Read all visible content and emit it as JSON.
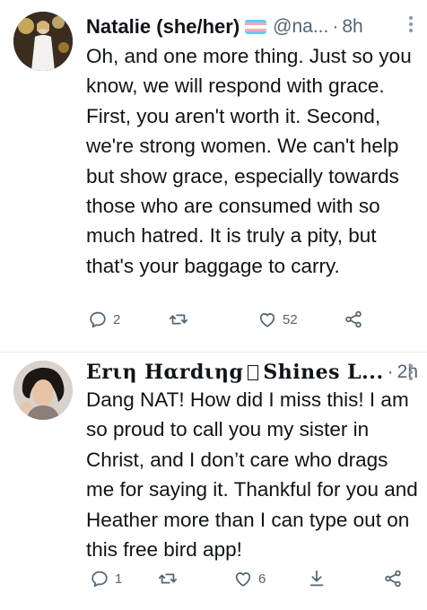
{
  "tweets": [
    {
      "author_name": "Natalie (she/her)",
      "handle": "@na...",
      "separator": "·",
      "time": "8h",
      "text": "Oh, and one more thing. Just so you know, we will respond with grace. First, you aren't worth it. Second, we're strong women. We can't help but show grace, especially towards those who are consumed with so much hatred. It is truly a pity, but that's your baggage to carry.",
      "replies": "2",
      "retweets": "",
      "likes": "52",
      "flag_colors": [
        "#5bcefa",
        "#f5a9b8",
        "#ffffff",
        "#f5a9b8",
        "#5bcefa"
      ]
    },
    {
      "author_name_fancy": "Erιη Hαrdιηg",
      "author_name_rest": "Shines L...",
      "separator": "·",
      "time": "2h",
      "text": "Dang NAT! How did I miss this! I am so proud to call you my sister in Christ, and I don’t care who drags me for saying it. Thankful for you and Heather more than I can type out on this free bird app!",
      "replies": "1",
      "retweets": "",
      "likes": "6"
    }
  ],
  "colors": {
    "text": "#0f1419",
    "secondary": "#536471",
    "divider": "#e6ecf0"
  },
  "icons": [
    "reply-icon",
    "retweet-icon",
    "like-icon",
    "share-icon",
    "more-icon",
    "download-icon"
  ]
}
